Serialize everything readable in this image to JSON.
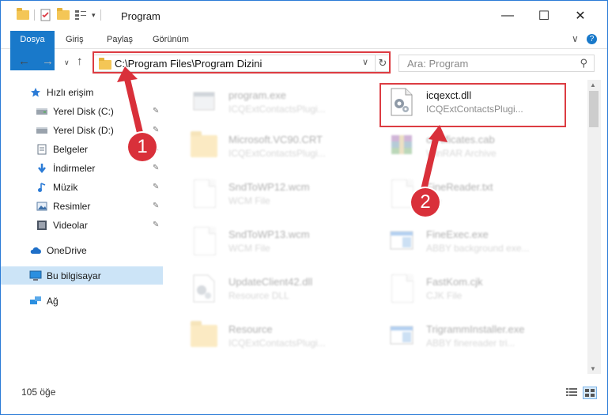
{
  "window": {
    "title": "Program",
    "controls": {
      "minimize": "—",
      "maximize": "☐",
      "close": "✕"
    }
  },
  "ribbon": {
    "tabs": [
      "Dosya",
      "Giriş",
      "Paylaş",
      "Görünüm"
    ],
    "expand": "∨",
    "help": "?"
  },
  "navigation": {
    "back": "←",
    "forward": "→",
    "recent": "∨",
    "up": "↑",
    "address": "C:\\Program Files\\Program Dizini",
    "address_dropdown": "∨",
    "refresh": "↻",
    "search_placeholder": "Ara: Program",
    "search_icon": "⚲"
  },
  "sidebar": {
    "items": [
      {
        "label": "Hızlı erişim",
        "icon": "star-icon"
      },
      {
        "label": "Yerel Disk (C:)",
        "icon": "drive-icon",
        "pinned": true
      },
      {
        "label": "Yerel Disk (D:)",
        "icon": "drive-icon",
        "pinned": true
      },
      {
        "label": "Belgeler",
        "icon": "documents-icon",
        "pinned": true
      },
      {
        "label": "İndirmeler",
        "icon": "download-icon",
        "pinned": true
      },
      {
        "label": "Müzik",
        "icon": "music-icon",
        "pinned": true
      },
      {
        "label": "Resimler",
        "icon": "pictures-icon",
        "pinned": true
      },
      {
        "label": "Videolar",
        "icon": "video-icon",
        "pinned": true
      },
      {
        "label": "OneDrive",
        "icon": "cloud-icon"
      },
      {
        "label": "Bu bilgisayar",
        "icon": "computer-icon",
        "selected": true
      },
      {
        "label": "Ağ",
        "icon": "network-icon"
      }
    ],
    "pin_glyph": "📌"
  },
  "files": [
    {
      "name": "program.exe",
      "type": "ICQExtContactsPlugi...",
      "icon": "exe-icon"
    },
    {
      "name": "icqexct.dll",
      "type": "ICQExtContactsPlugi...",
      "icon": "dll-gear-icon",
      "highlighted": true
    },
    {
      "name": "Microsoft.VC90.CRT",
      "type": "ICQExtContactsPlugi...",
      "icon": "folder-icon"
    },
    {
      "name": "certificates.cab",
      "type": "WinRAR Archive",
      "icon": "archive-icon"
    },
    {
      "name": "SndToWP12.wcm",
      "type": "WCM File",
      "icon": "document-icon"
    },
    {
      "name": "FineReader.txt",
      "type": "File",
      "icon": "document-icon"
    },
    {
      "name": "SndToWP13.wcm",
      "type": "WCM File",
      "icon": "document-icon"
    },
    {
      "name": "FineExec.exe",
      "type": "ABBY background exe...",
      "icon": "window-icon"
    },
    {
      "name": "UpdateClient42.dll",
      "type": "Resource DLL",
      "icon": "dll-gear-icon"
    },
    {
      "name": "FastKom.cjk",
      "type": "CJK File",
      "icon": "document-icon"
    },
    {
      "name": "Resource",
      "type": "ICQExtContactsPlugi...",
      "icon": "folder-icon"
    },
    {
      "name": "TrigrammInstaller.exe",
      "type": "ABBY finereader tri...",
      "icon": "window-icon"
    }
  ],
  "status": {
    "item_count": "105 öğe"
  },
  "annotations": {
    "step1": "1",
    "step2": "2"
  },
  "colors": {
    "accent": "#1979ca",
    "highlight": "#dc3c42",
    "selection": "#cce4f7"
  }
}
